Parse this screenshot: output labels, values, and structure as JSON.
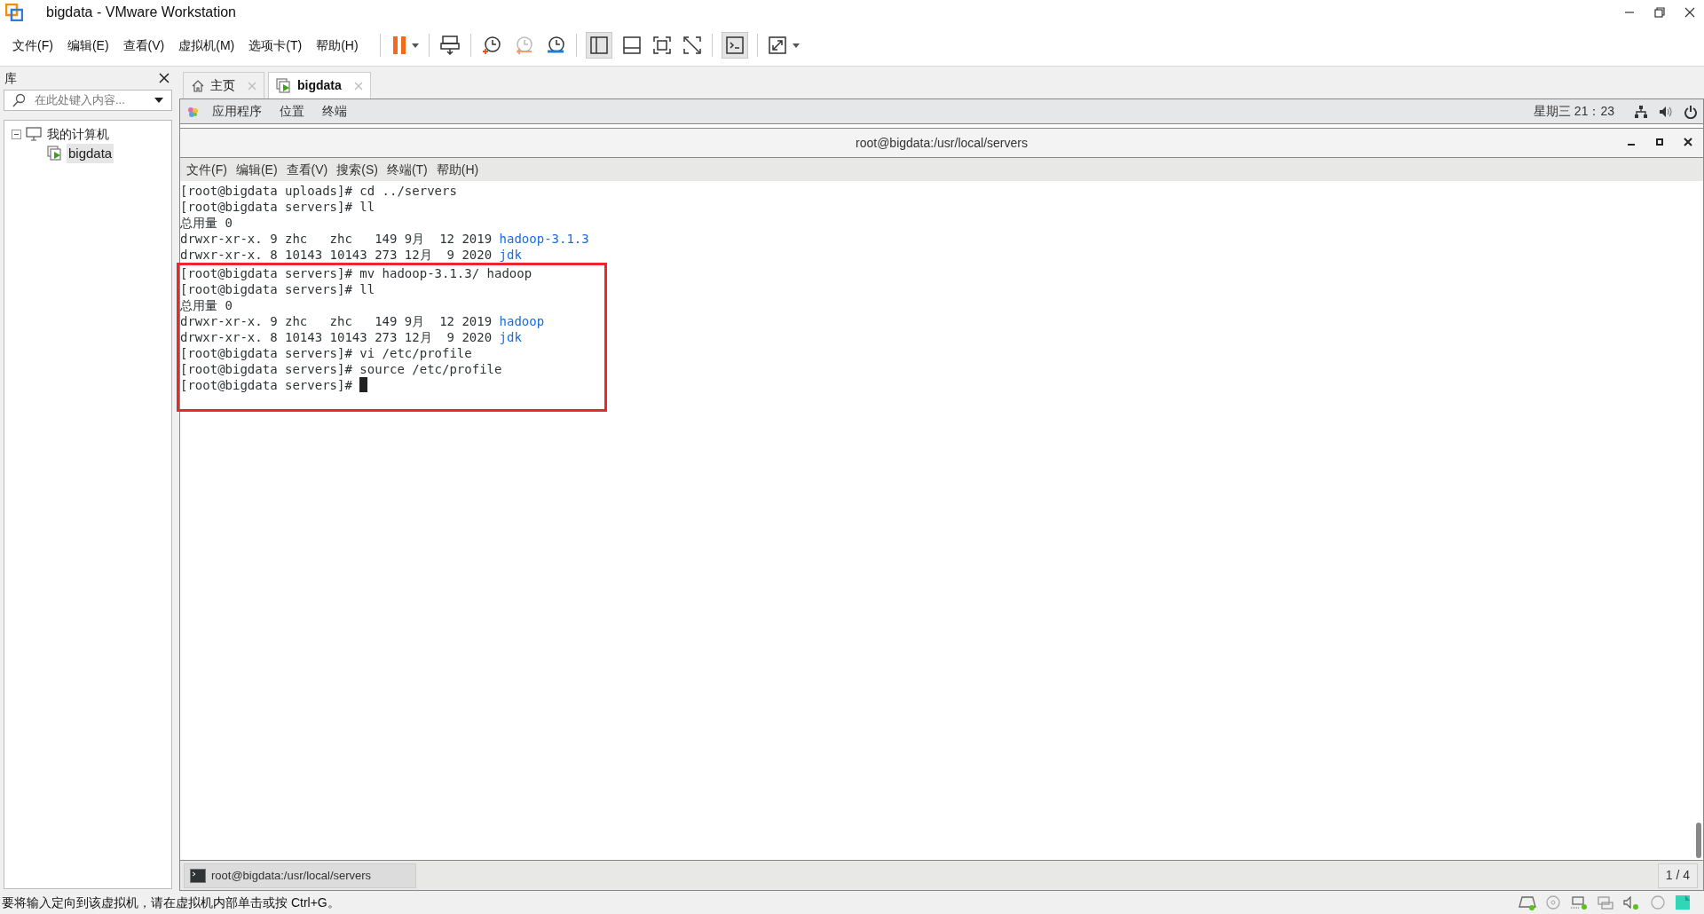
{
  "window": {
    "title": "bigdata - VMware Workstation"
  },
  "menu": [
    "文件(F)",
    "编辑(E)",
    "查看(V)",
    "虚拟机(M)",
    "选项卡(T)",
    "帮助(H)"
  ],
  "library": {
    "title": "库",
    "search": {
      "placeholder": "在此处键入内容..."
    },
    "tree": [
      {
        "label": "我的计算机",
        "expanded": true,
        "selected": false,
        "kind": "computer",
        "children": [
          {
            "label": "bigdata",
            "selected": true,
            "kind": "vm"
          }
        ]
      }
    ]
  },
  "tabs": [
    {
      "label": "主页",
      "kind": "home",
      "selected": false
    },
    {
      "label": "bigdata",
      "kind": "vm",
      "selected": true
    }
  ],
  "guest": {
    "top_bar": {
      "menus": [
        "应用程序",
        "位置",
        "终端"
      ],
      "clock": "星期三 21：23"
    },
    "terminal": {
      "title": "root@bigdata:/usr/local/servers",
      "menu": [
        "文件(F)",
        "编辑(E)",
        "查看(V)",
        "搜索(S)",
        "终端(T)",
        "帮助(H)"
      ],
      "blocks": [
        {
          "highlighted": false,
          "lines": [
            [
              {
                "text": "[root@bigdata uploads]# cd ../servers",
                "kind": "plain"
              }
            ],
            [
              {
                "text": "[root@bigdata servers]# ll",
                "kind": "plain"
              }
            ],
            [
              {
                "text": "总用量 0",
                "kind": "plain"
              }
            ],
            [
              {
                "text": "drwxr-xr-x. 9 zhc   zhc   149 9月  12 2019 ",
                "kind": "plain"
              },
              {
                "text": "hadoop-3.1.3",
                "kind": "dir"
              }
            ],
            [
              {
                "text": "drwxr-xr-x. 8 10143 10143 273 12月  9 2020 ",
                "kind": "plain"
              },
              {
                "text": "jdk",
                "kind": "dir"
              }
            ]
          ]
        },
        {
          "highlighted": true,
          "lines": [
            [
              {
                "text": "[root@bigdata servers]# mv hadoop-3.1.3/ hadoop",
                "kind": "plain"
              }
            ],
            [
              {
                "text": "[root@bigdata servers]# ll",
                "kind": "plain"
              }
            ],
            [
              {
                "text": "总用量 0",
                "kind": "plain"
              }
            ],
            [
              {
                "text": "drwxr-xr-x. 9 zhc   zhc   149 9月  12 2019 ",
                "kind": "plain"
              },
              {
                "text": "hadoop",
                "kind": "dir"
              }
            ],
            [
              {
                "text": "drwxr-xr-x. 8 10143 10143 273 12月  9 2020 ",
                "kind": "plain"
              },
              {
                "text": "jdk",
                "kind": "dir"
              }
            ],
            [
              {
                "text": "[root@bigdata servers]# vi /etc/profile",
                "kind": "plain"
              }
            ],
            [
              {
                "text": "[root@bigdata servers]# source /etc/profile",
                "kind": "plain"
              }
            ],
            [
              {
                "text": "[root@bigdata servers]# ",
                "kind": "plain"
              },
              {
                "kind": "cursor"
              }
            ]
          ]
        }
      ]
    },
    "taskbar": {
      "task": "root@bigdata:/usr/local/servers",
      "workspace": "1 / 4"
    }
  },
  "status_bar": "要将输入定向到该虚拟机，请在虚拟机内部单击或按 Ctrl+G。"
}
